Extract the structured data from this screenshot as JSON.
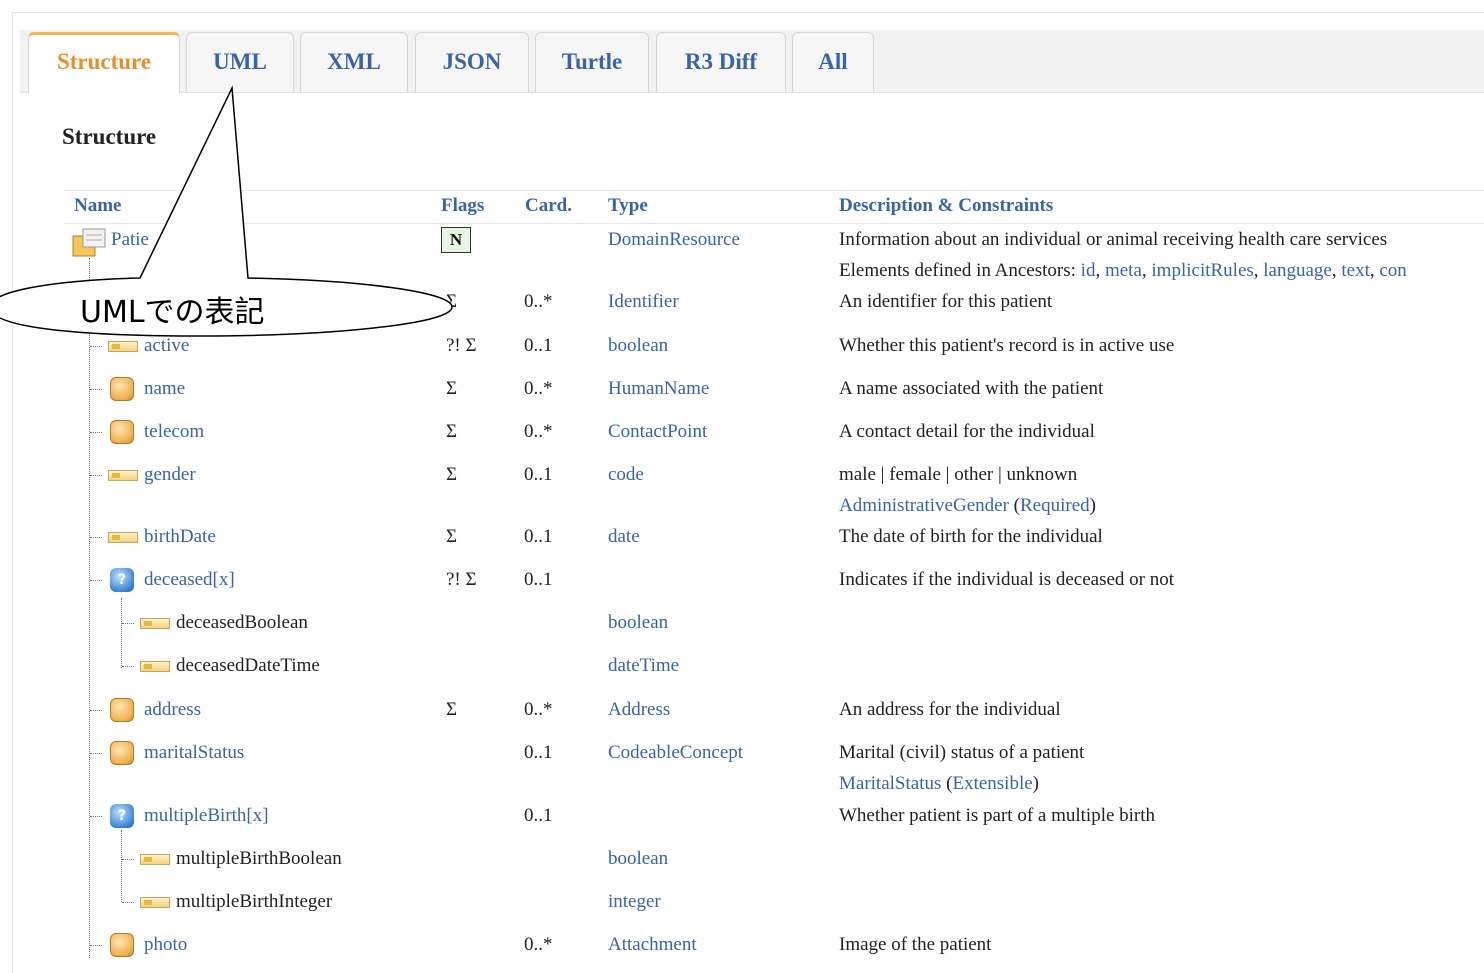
{
  "tabs": [
    {
      "label": "Structure",
      "active": true
    },
    {
      "label": "UML",
      "active": false
    },
    {
      "label": "XML",
      "active": false
    },
    {
      "label": "JSON",
      "active": false
    },
    {
      "label": "Turtle",
      "active": false
    },
    {
      "label": "R3 Diff",
      "active": false
    },
    {
      "label": "All",
      "active": false
    }
  ],
  "section_title": "Structure",
  "columns": {
    "name": "Name",
    "flags": "Flags",
    "card": "Card.",
    "type": "Type",
    "desc": "Description & Constraints"
  },
  "root": {
    "name": "Patient",
    "name_visible": "Patie",
    "flag": "N",
    "type": "DomainResource",
    "desc": "Information about an individual or animal receiving health care services",
    "ancestors_prefix": "Elements defined in Ancestors: ",
    "ancestors": [
      "id",
      "meta",
      "implicitRules",
      "language",
      "text",
      "con"
    ]
  },
  "rows": {
    "identifier": {
      "flags": "Σ",
      "card": "0..*",
      "type": "Identifier",
      "desc": "An identifier for this patient"
    },
    "active": {
      "name": "active",
      "flags": "?! Σ",
      "card": "0..1",
      "type": "boolean",
      "desc": "Whether this patient's record is in active use"
    },
    "name": {
      "name": "name",
      "flags": "Σ",
      "card": "0..*",
      "type": "HumanName",
      "desc": "A name associated with the patient"
    },
    "telecom": {
      "name": "telecom",
      "flags": "Σ",
      "card": "0..*",
      "type": "ContactPoint",
      "desc": "A contact detail for the individual"
    },
    "gender": {
      "name": "gender",
      "flags": "Σ",
      "card": "0..1",
      "type": "code",
      "desc": "male | female | other | unknown",
      "binding": "AdministrativeGender",
      "strength": "Required"
    },
    "birthDate": {
      "name": "birthDate",
      "flags": "Σ",
      "card": "0..1",
      "type": "date",
      "desc": "The date of birth for the individual"
    },
    "deceased": {
      "name": "deceased[x]",
      "flags": "?! Σ",
      "card": "0..1",
      "desc": "Indicates if the individual is deceased or not"
    },
    "deceasedBoolean": {
      "name": "deceasedBoolean",
      "type": "boolean"
    },
    "deceasedDateTime": {
      "name": "deceasedDateTime",
      "type": "dateTime"
    },
    "address": {
      "name": "address",
      "flags": "Σ",
      "card": "0..*",
      "type": "Address",
      "desc": "An address for the individual"
    },
    "maritalStatus": {
      "name": "maritalStatus",
      "card": "0..1",
      "type": "CodeableConcept",
      "desc": "Marital (civil) status of a patient",
      "binding": "MaritalStatus",
      "strength": "Extensible"
    },
    "multipleBirth": {
      "name": "multipleBirth[x]",
      "card": "0..1",
      "desc": "Whether patient is part of a multiple birth"
    },
    "multipleBirthBoolean": {
      "name": "multipleBirthBoolean",
      "type": "boolean"
    },
    "multipleBirthInteger": {
      "name": "multipleBirthInteger",
      "type": "integer"
    },
    "photo": {
      "name": "photo",
      "card": "0..*",
      "type": "Attachment",
      "desc": "Image of the patient"
    }
  },
  "choice_icon_glyph": "?",
  "callout": {
    "text": "UMLでの表記"
  }
}
